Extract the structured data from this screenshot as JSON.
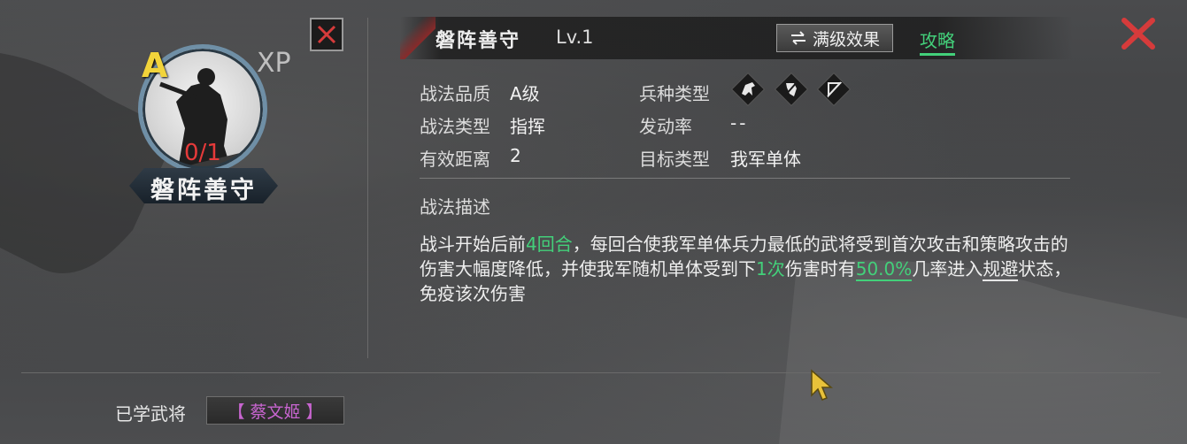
{
  "portrait": {
    "grade": "A",
    "xp": "XP",
    "count": "0/1",
    "skill_name": "磐阵善守"
  },
  "header": {
    "title": "磐阵善守",
    "level": "Lv.1",
    "max_effect_label": "满级效果",
    "strategy_link": "攻略"
  },
  "stats": {
    "quality_label": "战法品质",
    "quality_value": "A级",
    "type_label": "战法类型",
    "type_value": "指挥",
    "range_label": "有效距离",
    "range_value": "2",
    "troop_label": "兵种类型",
    "troop_icons": [
      "cavalry-icon",
      "shield-icon",
      "archer-icon"
    ],
    "trigger_label": "发动率",
    "trigger_value": "--",
    "target_label": "目标类型",
    "target_value": "我军单体"
  },
  "description": {
    "label": "战法描述",
    "t1": "战斗开始后前",
    "h1": "4回合",
    "t2": "，每回合使我军单体兵力最低的武将受到首次攻击和策略攻击的伤害大幅度降低，并使我军随机单体受到下",
    "h2": "1次",
    "t3": "伤害时有",
    "h3": "50.0%",
    "t4": "几率进入",
    "u1": "规避",
    "t5": "状态，免疫该次伤害"
  },
  "footer": {
    "learned_label": "已学武将",
    "general": "【 蔡文姬 】"
  },
  "colors": {
    "highlight": "#43d07a",
    "close_red": "#d63b3b",
    "grade_gold": "#f2d43a",
    "general_purple": "#c865d0"
  }
}
